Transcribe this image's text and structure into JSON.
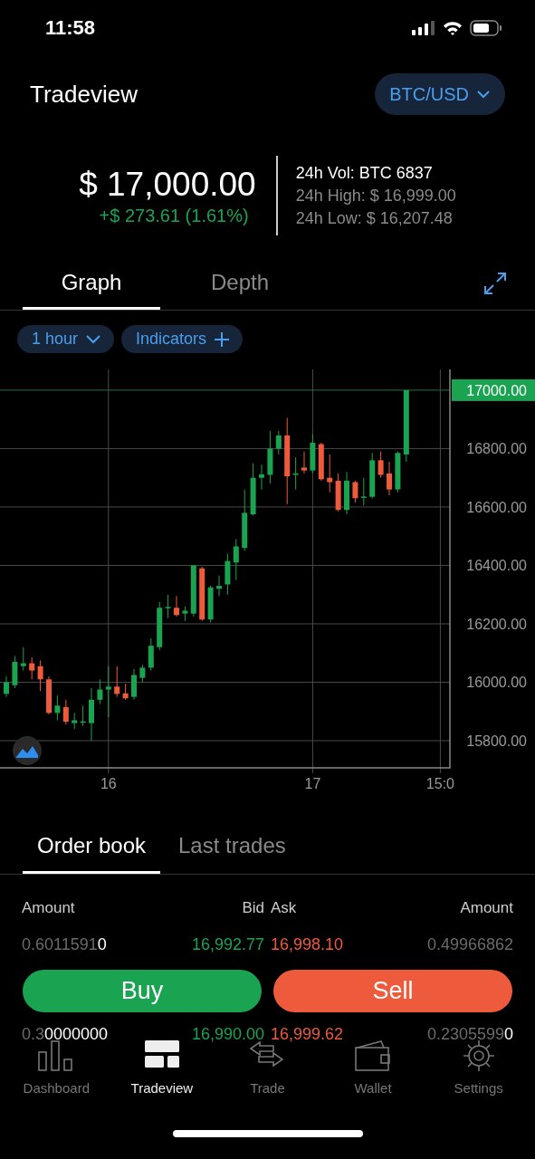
{
  "status_bar": {
    "time": "11:58"
  },
  "header": {
    "title": "Tradeview",
    "pair": "BTC/USD"
  },
  "ticker": {
    "price": "$ 17,000.00",
    "change": "+$ 273.61 (1.61%)",
    "volume": "24h Vol: BTC  6837",
    "high": "24h High: $ 16,999.00",
    "low": "24h Low: $ 16,207.48"
  },
  "chart_tabs": [
    {
      "label": "Graph",
      "selected": true
    },
    {
      "label": "Depth",
      "selected": false
    }
  ],
  "chart_controls": [
    {
      "label": "1 hour",
      "kind": "dropdown"
    },
    {
      "label": "Indicators",
      "kind": "add"
    }
  ],
  "chart": {
    "current_price": "17000.00",
    "chart_data": {
      "type": "candlestick",
      "categories": [
        null,
        null,
        null,
        null,
        null,
        null,
        null,
        null,
        null,
        null,
        null,
        null,
        "16",
        null,
        null,
        null,
        null,
        null,
        null,
        null,
        null,
        null,
        null,
        null,
        null,
        null,
        null,
        null,
        null,
        null,
        null,
        null,
        null,
        null,
        null,
        null,
        "17",
        null,
        null,
        null,
        null,
        null,
        null,
        null,
        null,
        null,
        null,
        null,
        null,
        null,
        null,
        "15:0"
      ],
      "ohlc": [
        [
          15960,
          16020,
          15950,
          16000
        ],
        [
          15990,
          16090,
          15980,
          16070
        ],
        [
          16055,
          16120,
          16040,
          16065
        ],
        [
          16065,
          16085,
          16010,
          16040
        ],
        [
          16055,
          16075,
          15970,
          16010
        ],
        [
          16010,
          16020,
          15890,
          15895
        ],
        [
          15895,
          15955,
          15870,
          15920
        ],
        [
          15915,
          15940,
          15855,
          15865
        ],
        [
          15860,
          15895,
          15840,
          15870
        ],
        [
          15863,
          15920,
          15850,
          15866
        ],
        [
          15860,
          15980,
          15800,
          15940
        ],
        [
          15940,
          16010,
          15925,
          15975
        ],
        [
          15975,
          16055,
          15880,
          15985
        ],
        [
          15985,
          16055,
          15950,
          15960
        ],
        [
          15962,
          15995,
          15940,
          15945
        ],
        [
          15950,
          16045,
          15940,
          16025
        ],
        [
          16015,
          16060,
          16000,
          16050
        ],
        [
          16050,
          16150,
          16040,
          16125
        ],
        [
          16120,
          16275,
          16110,
          16255
        ],
        [
          16256,
          16300,
          16220,
          16258
        ],
        [
          16255,
          16295,
          16225,
          16230
        ],
        [
          16235,
          16260,
          16210,
          16245
        ],
        [
          16235,
          16400,
          16225,
          16400
        ],
        [
          16390,
          16395,
          16210,
          16215
        ],
        [
          16215,
          16330,
          16205,
          16325
        ],
        [
          16320,
          16365,
          16295,
          16330
        ],
        [
          16335,
          16440,
          16300,
          16415
        ],
        [
          16410,
          16490,
          16350,
          16465
        ],
        [
          16460,
          16660,
          16450,
          16580
        ],
        [
          16575,
          16750,
          16570,
          16700
        ],
        [
          16700,
          16745,
          16660,
          16712
        ],
        [
          16710,
          16860,
          16680,
          16800
        ],
        [
          16800,
          16860,
          16780,
          16845
        ],
        [
          16845,
          16905,
          16610,
          16705
        ],
        [
          16710,
          16770,
          16660,
          16715
        ],
        [
          16735,
          16790,
          16715,
          16725
        ],
        [
          16725,
          16850,
          16715,
          16820
        ],
        [
          16815,
          16820,
          16690,
          16695
        ],
        [
          16700,
          16780,
          16650,
          16685
        ],
        [
          16690,
          16715,
          16585,
          16590
        ],
        [
          16590,
          16720,
          16575,
          16690
        ],
        [
          16685,
          16690,
          16615,
          16630
        ],
        [
          16634,
          16700,
          16605,
          16636
        ],
        [
          16635,
          16785,
          16630,
          16760
        ],
        [
          16760,
          16790,
          16700,
          16710
        ],
        [
          16715,
          16755,
          16640,
          16660
        ],
        [
          16660,
          16790,
          16650,
          16785
        ],
        [
          16780,
          17000,
          16755,
          17000
        ],
        null,
        null,
        null,
        null
      ],
      "grid": true,
      "ref_lines": [
        {
          "axis": "y",
          "value": 17000
        }
      ],
      "ylim": [
        15707,
        17071
      ],
      "yticks": [
        {
          "value": 15800,
          "label": "15800.00"
        },
        {
          "value": 16000,
          "label": "16000.00"
        },
        {
          "value": 16200,
          "label": "16200.00"
        },
        {
          "value": 16400,
          "label": "16400.00"
        },
        {
          "value": 16600,
          "label": "16600.00"
        },
        {
          "value": 16800,
          "label": "16800.00"
        }
      ]
    }
  },
  "order_tabs": [
    {
      "label": "Order book",
      "selected": true
    },
    {
      "label": "Last trades",
      "selected": false
    }
  ],
  "order_book": {
    "columns": [
      "Amount",
      "Bid",
      "Ask",
      "Amount"
    ],
    "rows": [
      {
        "bid_amount": {
          "muted": "0.6011591",
          "bright": "0"
        },
        "bid": "16,992.77",
        "ask": "16,998.10",
        "ask_amount": {
          "muted": "0.49966862"
        }
      },
      {
        "bid_amount": {
          "muted": "0.3",
          "bright": "0000000"
        },
        "bid": "16,990.00",
        "ask": "16,999.62",
        "ask_amount": {
          "muted": "0.2305599",
          "bright": "0"
        }
      }
    ]
  },
  "actions": [
    {
      "label": "Buy",
      "kind": "buy"
    },
    {
      "label": "Sell",
      "kind": "sell"
    }
  ],
  "nav": [
    {
      "label": "Dashboard",
      "kind": "bars",
      "selected": false
    },
    {
      "label": "Tradeview",
      "kind": "layout",
      "selected": true
    },
    {
      "label": "Trade",
      "kind": "swap",
      "selected": false
    },
    {
      "label": "Wallet",
      "kind": "wallet",
      "selected": false
    },
    {
      "label": "Settings",
      "kind": "gear",
      "selected": false
    }
  ]
}
